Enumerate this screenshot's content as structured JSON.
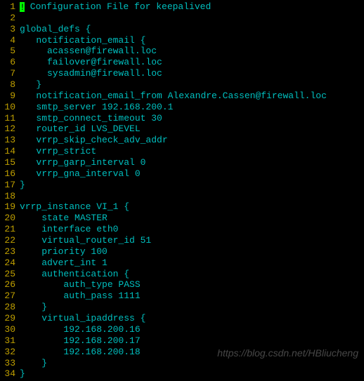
{
  "lines": [
    {
      "num": 1,
      "text": " Configuration File for keepalived",
      "cursor": true
    },
    {
      "num": 2,
      "text": ""
    },
    {
      "num": 3,
      "text": "global_defs {"
    },
    {
      "num": 4,
      "text": "   notification_email {"
    },
    {
      "num": 5,
      "text": "     acassen@firewall.loc"
    },
    {
      "num": 6,
      "text": "     failover@firewall.loc"
    },
    {
      "num": 7,
      "text": "     sysadmin@firewall.loc"
    },
    {
      "num": 8,
      "text": "   }"
    },
    {
      "num": 9,
      "text": "   notification_email_from Alexandre.Cassen@firewall.loc"
    },
    {
      "num": 10,
      "text": "   smtp_server 192.168.200.1"
    },
    {
      "num": 11,
      "text": "   smtp_connect_timeout 30"
    },
    {
      "num": 12,
      "text": "   router_id LVS_DEVEL"
    },
    {
      "num": 13,
      "text": "   vrrp_skip_check_adv_addr"
    },
    {
      "num": 14,
      "text": "   vrrp_strict"
    },
    {
      "num": 15,
      "text": "   vrrp_garp_interval 0"
    },
    {
      "num": 16,
      "text": "   vrrp_gna_interval 0"
    },
    {
      "num": 17,
      "text": "}"
    },
    {
      "num": 18,
      "text": ""
    },
    {
      "num": 19,
      "text": "vrrp_instance VI_1 {"
    },
    {
      "num": 20,
      "text": "    state MASTER"
    },
    {
      "num": 21,
      "text": "    interface eth0"
    },
    {
      "num": 22,
      "text": "    virtual_router_id 51"
    },
    {
      "num": 23,
      "text": "    priority 100"
    },
    {
      "num": 24,
      "text": "    advert_int 1"
    },
    {
      "num": 25,
      "text": "    authentication {"
    },
    {
      "num": 26,
      "text": "        auth_type PASS"
    },
    {
      "num": 27,
      "text": "        auth_pass 1111"
    },
    {
      "num": 28,
      "text": "    }"
    },
    {
      "num": 29,
      "text": "    virtual_ipaddress {"
    },
    {
      "num": 30,
      "text": "        192.168.200.16"
    },
    {
      "num": 31,
      "text": "        192.168.200.17"
    },
    {
      "num": 32,
      "text": "        192.168.200.18"
    },
    {
      "num": 33,
      "text": "    }"
    },
    {
      "num": 34,
      "text": "}"
    }
  ],
  "watermark": "https://blog.csdn.net/HBliucheng"
}
